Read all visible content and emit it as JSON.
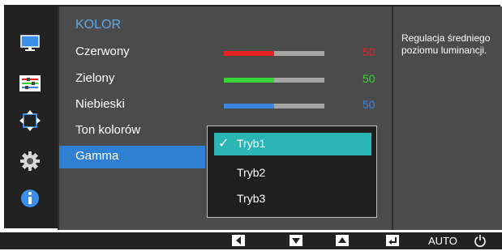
{
  "menu": {
    "title": "KOLOR",
    "items": [
      {
        "label": "Czerwony",
        "value": "50",
        "value_color": "#e32222",
        "fill_color": "#e32222",
        "fill": 0.5
      },
      {
        "label": "Zielony",
        "value": "50",
        "value_color": "#39d435",
        "fill_color": "#39d435",
        "fill": 0.5
      },
      {
        "label": "Niebieski",
        "value": "50",
        "value_color": "#3a86e3",
        "fill_color": "#3a86e3",
        "fill": 0.5
      },
      {
        "label": "Ton kolorów"
      },
      {
        "label": "Gamma"
      }
    ]
  },
  "dropdown": {
    "options": [
      "Tryb1",
      "Tryb2",
      "Tryb3"
    ],
    "selected": "Tryb1"
  },
  "info": {
    "text": "Regulacja średniego poziomu luminancji."
  },
  "bottom_bar": {
    "icons": [
      "left-arrow-icon",
      "down-arrow-icon",
      "up-arrow-icon",
      "enter-icon",
      "power-icon"
    ],
    "auto_label": "AUTO"
  },
  "colors": {
    "accent": "#2f7fd3",
    "highlight": "#2bb5b5",
    "title": "#5aa9ec"
  }
}
